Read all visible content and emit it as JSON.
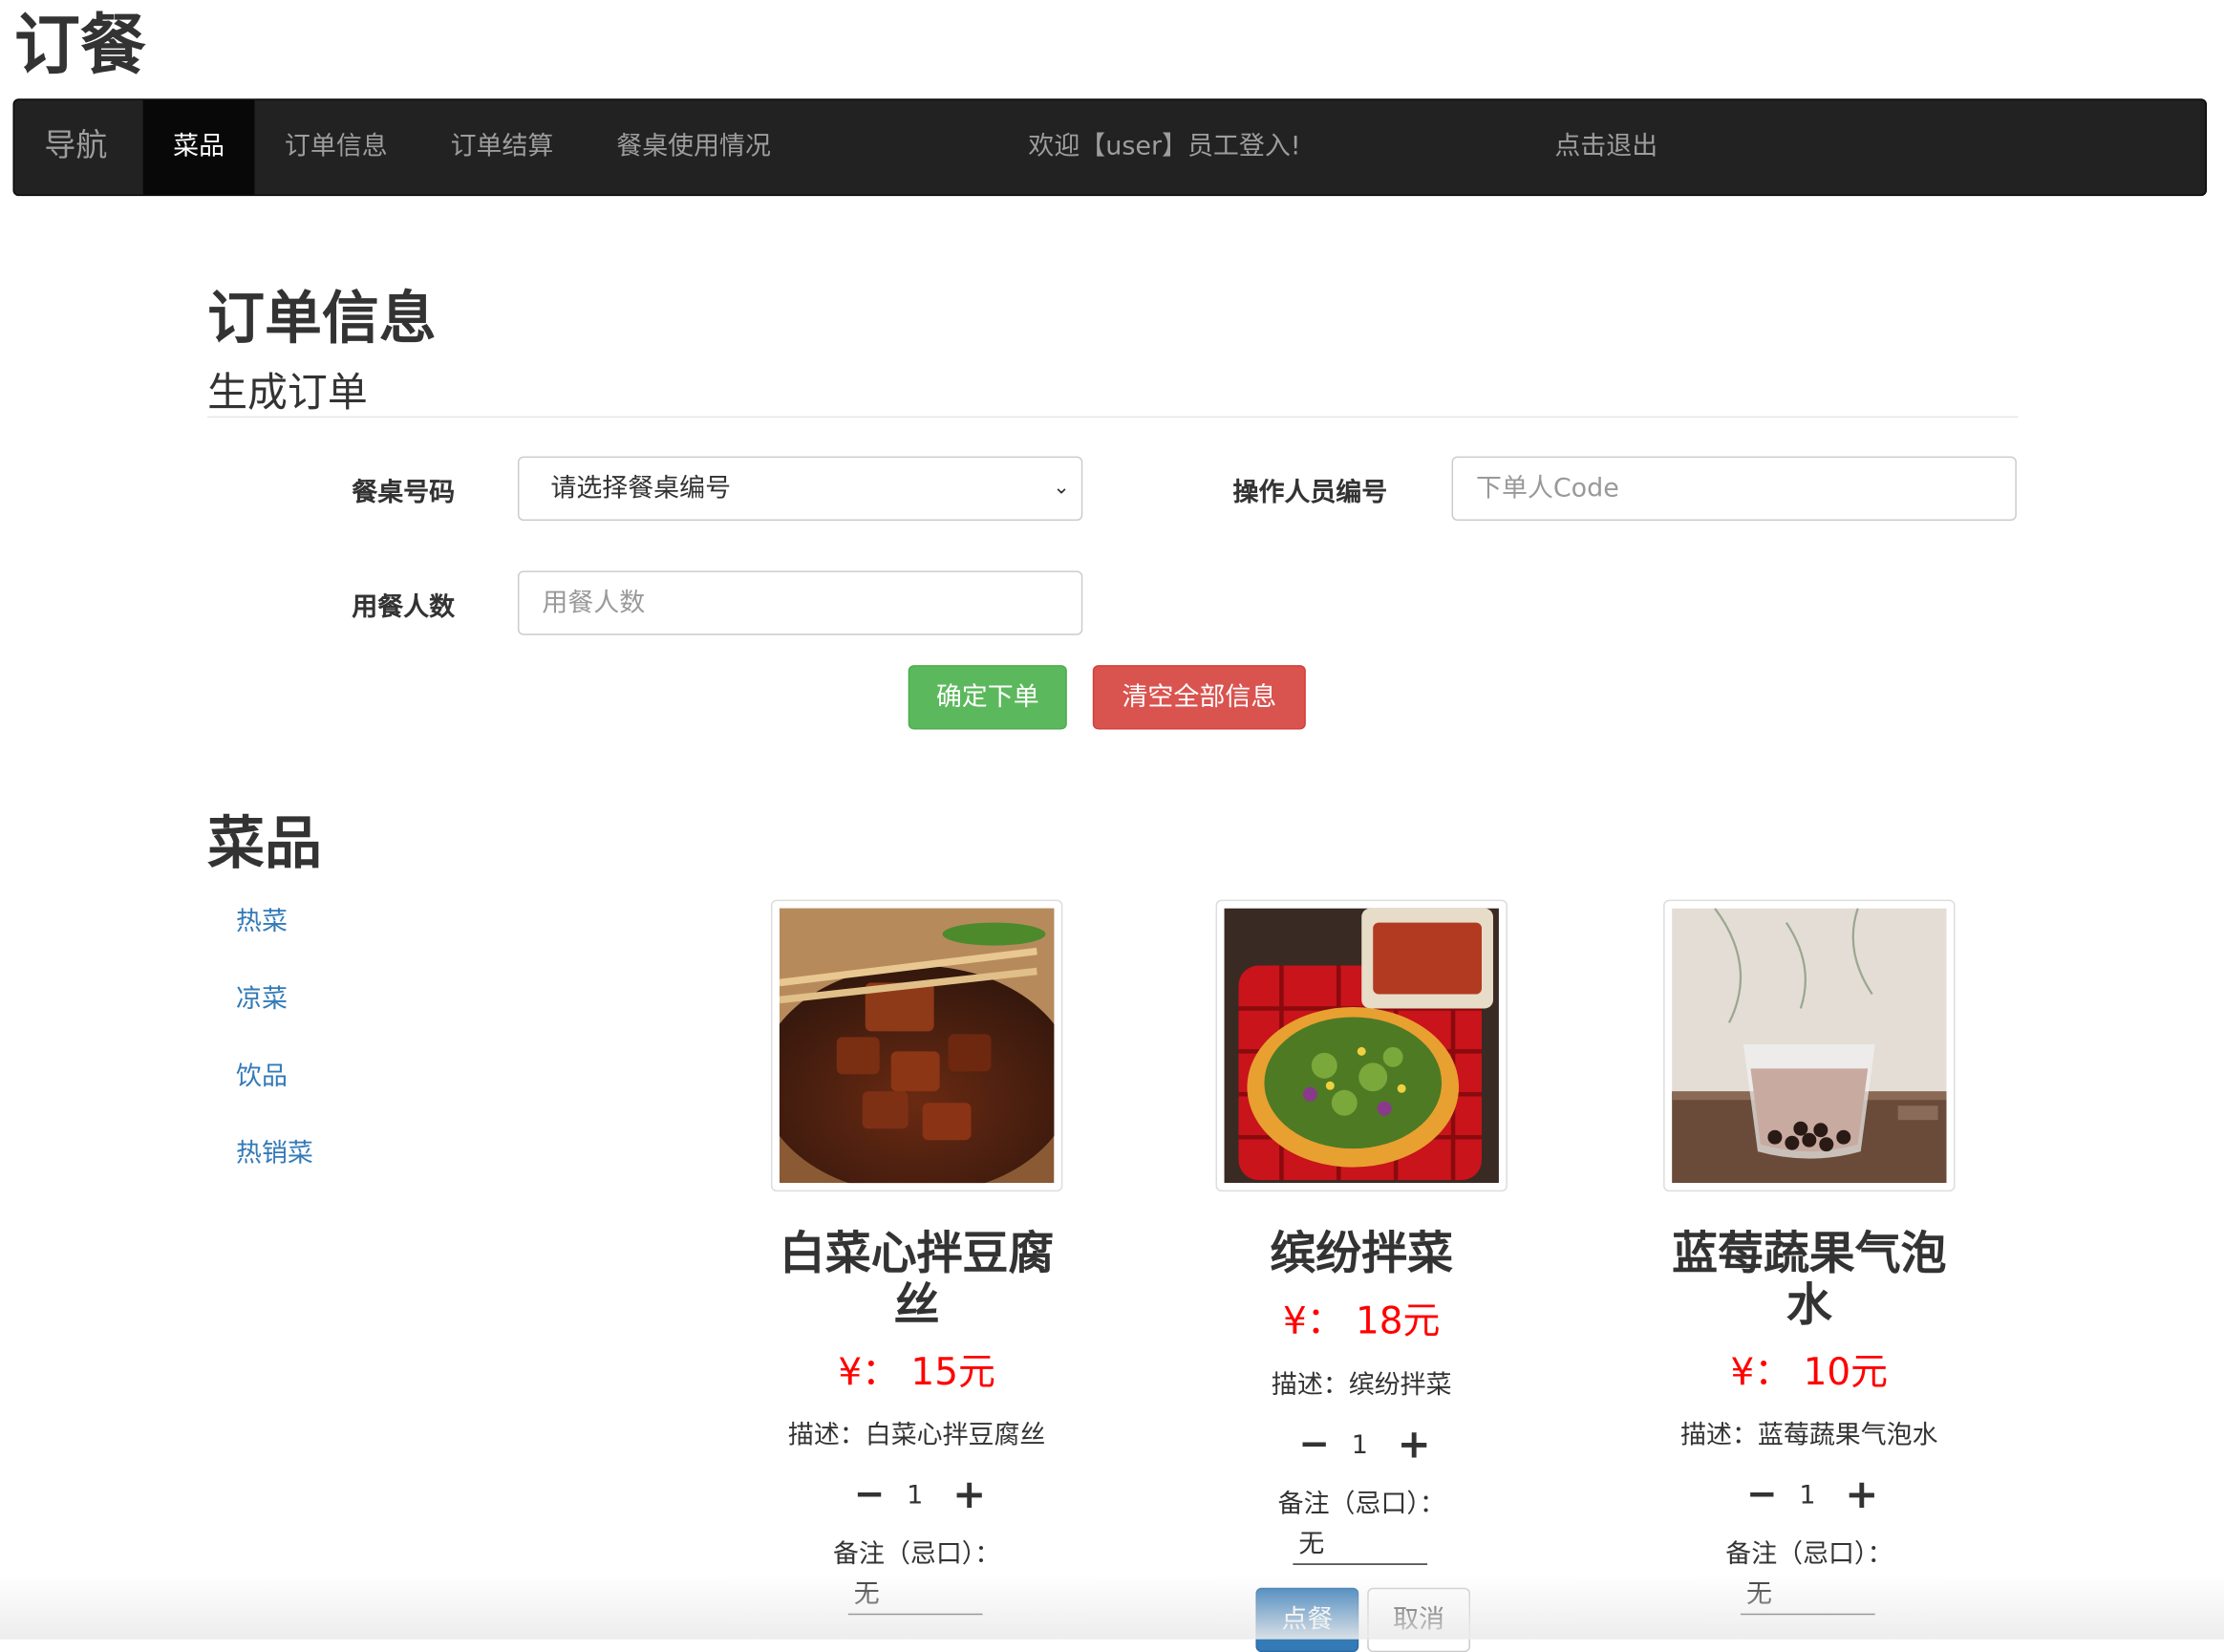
{
  "app": {
    "title": "订餐"
  },
  "navbar": {
    "brand": "导航",
    "items": [
      {
        "label": "菜品",
        "active": true
      },
      {
        "label": "订单信息",
        "active": false
      },
      {
        "label": "订单结算",
        "active": false
      },
      {
        "label": "餐桌使用情况",
        "active": false
      }
    ],
    "welcome": "欢迎【user】员工登入!",
    "logout": "点击退出"
  },
  "order": {
    "heading": "订单信息",
    "subheading": "生成订单",
    "table_label": "餐桌号码",
    "table_select_value": "请选择餐桌编号",
    "operator_label": "操作人员编号",
    "operator_placeholder": "下单人Code",
    "diners_label": "用餐人数",
    "diners_placeholder": "用餐人数",
    "submit_label": "确定下单",
    "clear_label": "清空全部信息"
  },
  "dishes_section": {
    "heading": "菜品",
    "categories": [
      "热菜",
      "凉菜",
      "饮品",
      "热销菜"
    ]
  },
  "dishes": [
    {
      "name": "白菜心拌豆腐丝",
      "price": "¥： 15元",
      "desc": "描述：白菜心拌豆腐丝",
      "qty": "1",
      "note_label": "备注（忌口）：",
      "note_value": "无",
      "image": "braised-pork-image"
    },
    {
      "name": "缤纷拌菜",
      "price": "¥： 18元",
      "desc": "描述：缤纷拌菜",
      "qty": "1",
      "note_label": "备注（忌口）：",
      "note_value": "无",
      "image": "mixed-salad-image",
      "order_label": "点餐",
      "cancel_label": "取消"
    },
    {
      "name": "蓝莓蔬果气泡水",
      "price": "¥： 10元",
      "desc": "描述：蓝莓蔬果气泡水",
      "qty": "1",
      "note_label": "备注（忌口）：",
      "note_value": "无",
      "image": "bubble-tea-image"
    }
  ],
  "colors": {
    "navbar_bg": "#222222",
    "link": "#337ab7",
    "price": "#ff0000",
    "success": "#5cb85c",
    "danger": "#d9534f",
    "primary": "#337ab7"
  },
  "icons": {
    "minus": "−",
    "plus": "+",
    "select_caret": "⌄"
  }
}
